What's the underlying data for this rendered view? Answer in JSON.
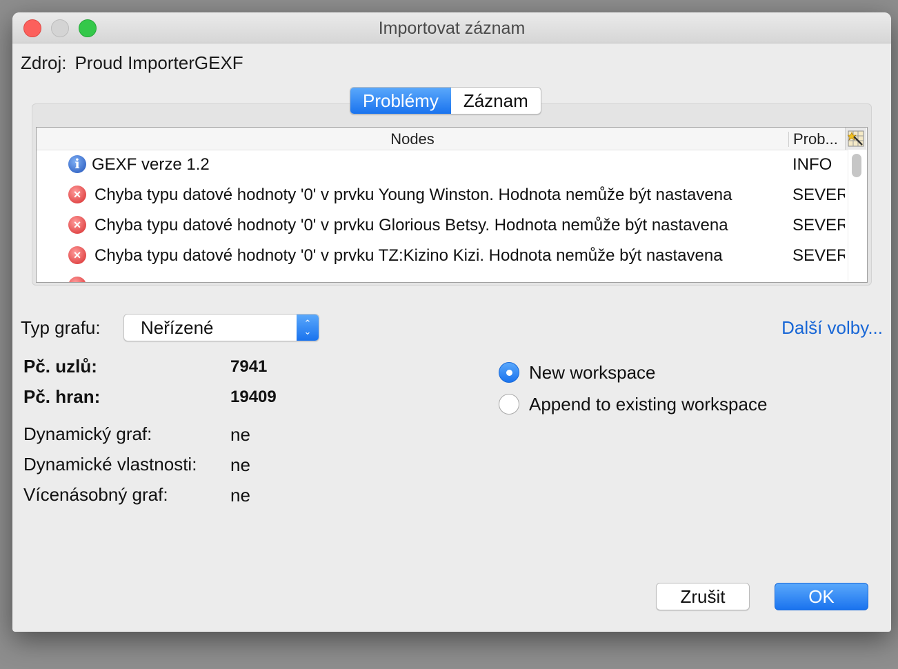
{
  "window": {
    "title": "Importovat záznam"
  },
  "source": {
    "label": "Zdroj:",
    "value": "Proud ImporterGEXF"
  },
  "tabs": [
    {
      "label": "Problémy",
      "active": true
    },
    {
      "label": "Záznam",
      "active": false
    }
  ],
  "issues_table": {
    "columns": [
      "Nodes",
      "Prob..."
    ],
    "rows": [
      {
        "icon": "info-icon",
        "message": "GEXF verze 1.2",
        "level": "INFO"
      },
      {
        "icon": "error-icon",
        "message": "Chyba typu datové hodnoty '0' v prvku Young Winston. Hodnota nemůže být nastavena",
        "level": "SEVERE"
      },
      {
        "icon": "error-icon",
        "message": "Chyba typu datové hodnoty '0' v prvku Glorious Betsy. Hodnota nemůže být nastavena",
        "level": "SEVERE"
      },
      {
        "icon": "error-icon",
        "message": "Chyba typu datové hodnoty '0' v prvku TZ:Kizino Kizi. Hodnota nemůže být nastavena",
        "level": "SEVERE"
      }
    ]
  },
  "graph_type": {
    "label": "Typ grafu:",
    "selected": "Neřízené"
  },
  "more_options": "Další volby...",
  "stats": {
    "nodes_label": "Pč. uzlů:",
    "nodes_value": "7941",
    "edges_label": "Pč. hran:",
    "edges_value": "19409",
    "dynamic_graph_label": "Dynamický graf:",
    "dynamic_graph_value": "ne",
    "dynamic_props_label": "Dynamické vlastnosti:",
    "dynamic_props_value": "ne",
    "multi_graph_label": "Vícenásobný graf:",
    "multi_graph_value": "ne"
  },
  "workspace": {
    "options": [
      {
        "label": "New workspace",
        "selected": true
      },
      {
        "label": "Append to existing workspace",
        "selected": false
      }
    ]
  },
  "buttons": {
    "cancel": "Zrušit",
    "ok": "OK"
  },
  "colors": {
    "accent": "#1a73ee",
    "link": "#1766d6",
    "error": "#d62a2a",
    "info": "#2152b8"
  }
}
